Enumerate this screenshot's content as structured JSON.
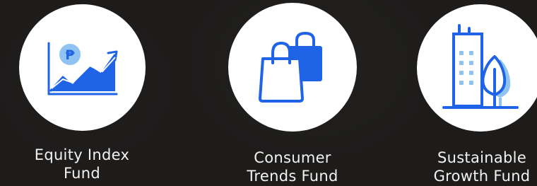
{
  "funds": [
    {
      "label_line1": "Equity Index",
      "label_line2": "Fund",
      "icon": "peso-growth-chart-icon",
      "color_primary": "#1f63e6",
      "color_light": "#8ec3f2"
    },
    {
      "label_line1": "Consumer",
      "label_line2": "Trends Fund",
      "icon": "shopping-bags-icon",
      "color_primary": "#1f63e6",
      "color_light": "#8ec3f2"
    },
    {
      "label_line1": "Sustainable",
      "label_line2": "Growth Fund",
      "icon": "green-building-tree-icon",
      "color_primary": "#1f63e6",
      "color_light": "#8ec3f2"
    }
  ]
}
